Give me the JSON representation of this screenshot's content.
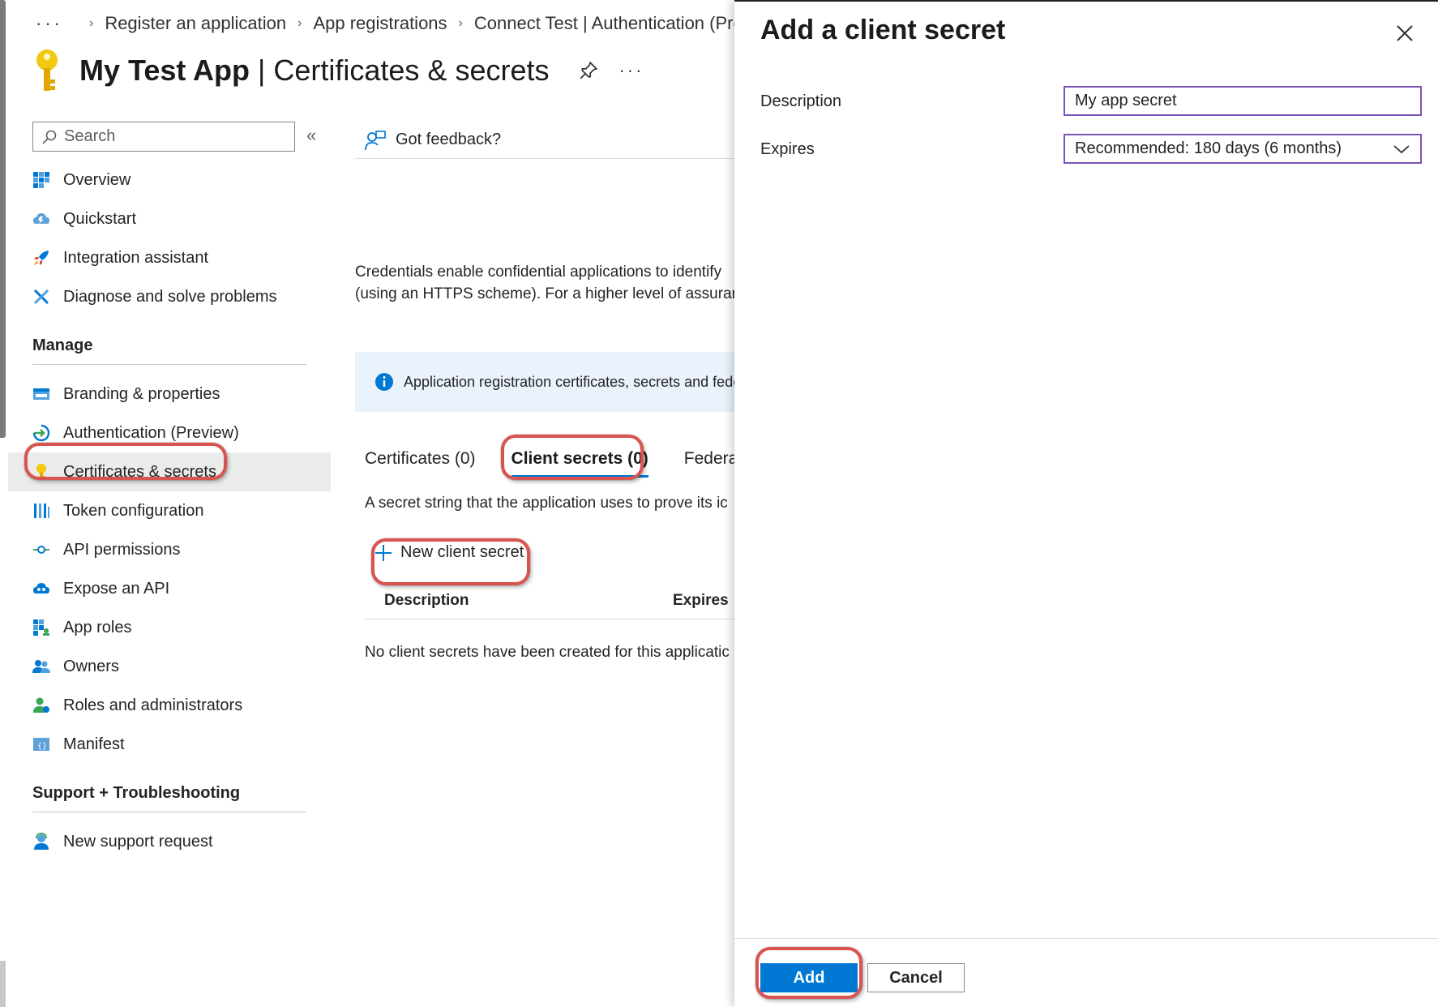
{
  "breadcrumb": {
    "ellipsis": "···",
    "items": [
      "Register an application",
      "App registrations",
      "Connect Test | Authentication (Preview)"
    ]
  },
  "header": {
    "app_name": "My Test App",
    "separator": " | ",
    "section": "Certificates & secrets",
    "more": "···"
  },
  "sidebar": {
    "search_placeholder": "Search",
    "collapse": "«",
    "items_top": [
      {
        "label": "Overview",
        "icon": "grid-icon"
      },
      {
        "label": "Quickstart",
        "icon": "cloud-icon"
      },
      {
        "label": "Integration assistant",
        "icon": "rocket-icon"
      },
      {
        "label": "Diagnose and solve problems",
        "icon": "tools-icon"
      }
    ],
    "manage_header": "Manage",
    "items_manage": [
      {
        "label": "Branding & properties",
        "icon": "branding-icon"
      },
      {
        "label": "Authentication (Preview)",
        "icon": "authentication-icon"
      },
      {
        "label": "Certificates & secrets",
        "icon": "key-icon"
      },
      {
        "label": "Token configuration",
        "icon": "token-bars-icon"
      },
      {
        "label": "API permissions",
        "icon": "api-permissions-icon"
      },
      {
        "label": "Expose an API",
        "icon": "cloud-api-icon"
      },
      {
        "label": "App roles",
        "icon": "app-roles-icon"
      },
      {
        "label": "Owners",
        "icon": "owners-icon"
      },
      {
        "label": "Roles and administrators",
        "icon": "roles-admin-icon"
      },
      {
        "label": "Manifest",
        "icon": "manifest-icon"
      }
    ],
    "support_header": "Support + Troubleshooting",
    "items_support": [
      {
        "label": "New support request",
        "icon": "support-person-icon"
      }
    ]
  },
  "main": {
    "feedback": "Got feedback?",
    "credentials_line1": "Credentials enable confidential applications to identify",
    "credentials_line2": "(using an HTTPS scheme). For a higher level of assuran",
    "info_text": "Application registration certificates, secrets and fede",
    "tabs": [
      "Certificates (0)",
      "Client secrets (0)",
      "Federated"
    ],
    "secret_description": "A secret string that the application uses to prove its ic",
    "new_secret": "New client secret",
    "table_headers": [
      "Description",
      "Expires"
    ],
    "empty_message": "No client secrets have been created for this applicatic"
  },
  "panel": {
    "title": "Add a client secret",
    "description_label": "Description",
    "description_value": "My app secret",
    "expires_label": "Expires",
    "expires_value": "Recommended: 180 days (6 months)",
    "add_label": "Add",
    "cancel_label": "Cancel"
  },
  "colors": {
    "accent": "#0078d4",
    "highlight": "#d9534f",
    "input_border": "#7b53b6",
    "info_bg": "#eaf2fb"
  }
}
